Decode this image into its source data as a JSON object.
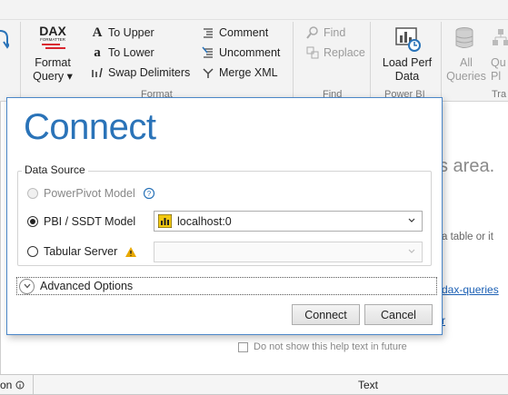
{
  "ribbon": {
    "dax_logo_text": "DAX",
    "dax_logo_subtext": "FORMATTER",
    "format_query_label_1": "Format",
    "format_query_label_2": "Query ▾",
    "to_upper": "To Upper",
    "to_lower": "To Lower",
    "swap_delimiters": "Swap Delimiters",
    "comment": "Comment",
    "uncomment": "Uncomment",
    "merge_xml": "Merge XML",
    "find": "Find",
    "replace": "Replace",
    "load_perf_data_1": "Load Perf",
    "load_perf_data_2": "Data",
    "all_queries_1": "All",
    "all_queries_2": "Queries",
    "query_plan_1": "Qu",
    "query_plan_2": "Pl",
    "group_format": "Format",
    "group_find": "Find",
    "group_powerbi": "Power BI",
    "group_traces": "Tra"
  },
  "help": {
    "title_fragment": "s area.",
    "text_fragment": "a table or it",
    "link1_fragment": "dax-queries",
    "link2_fragment": "r",
    "no_show_label": "Do not show this help text in future"
  },
  "grid": {
    "col1_label": "on",
    "col2_label": "Text"
  },
  "dialog": {
    "title": "Connect",
    "data_source_label": "Data Source",
    "powerpivot_label": "PowerPivot Model",
    "pbi_label": "PBI / SSDT Model",
    "pbi_value": "localhost:0",
    "tabular_label": "Tabular Server",
    "tabular_value": "",
    "advanced_label": "Advanced Options",
    "connect_button": "Connect",
    "cancel_button": "Cancel"
  },
  "colors": {
    "accent": "#2a73b8",
    "warning": "#e8a800",
    "pbi_icon": "#f2c811"
  }
}
